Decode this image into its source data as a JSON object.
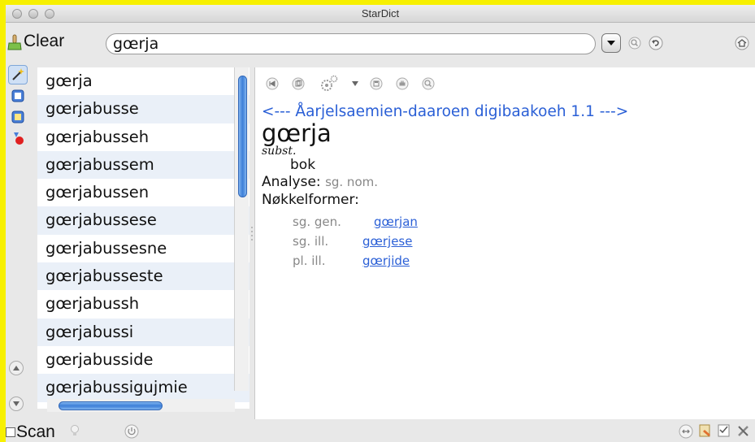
{
  "window": {
    "title": "StarDict"
  },
  "search": {
    "clear_label": "Clear",
    "value": "gœrja"
  },
  "word_list": [
    "gœrja",
    "gœrjabusse",
    "gœrjabusseh",
    "gœrjabussem",
    "gœrjabussen",
    "gœrjabussese",
    "gœrjabussesne",
    "gœrjabusseste",
    "gœrjabussh",
    "gœrjabussi",
    "gœrjabusside",
    "gœrjabussigujmie"
  ],
  "entry": {
    "dictionary": "<--- Åarjelsaemien-daaroen digibaakoeh 1.1 --->",
    "headword": "gœrja",
    "pos": "subst.",
    "meaning": "bok",
    "analysis_label": "Analyse:",
    "analysis_value": "sg. nom.",
    "key_forms_label": "Nøkkelformer:",
    "forms": [
      {
        "tag": "sg. gen.",
        "word": "gœrjan"
      },
      {
        "tag": "sg. ill.",
        "word": "gœrjese"
      },
      {
        "tag": "pl. ill.",
        "word": "gœrjide"
      }
    ]
  },
  "bottom": {
    "scan_label": "Scan"
  },
  "colors": {
    "frame": "#f7f000",
    "link": "#2a5fd6",
    "stripe": "#eaf0f8",
    "scroll_thumb": "#3d7fd8"
  }
}
